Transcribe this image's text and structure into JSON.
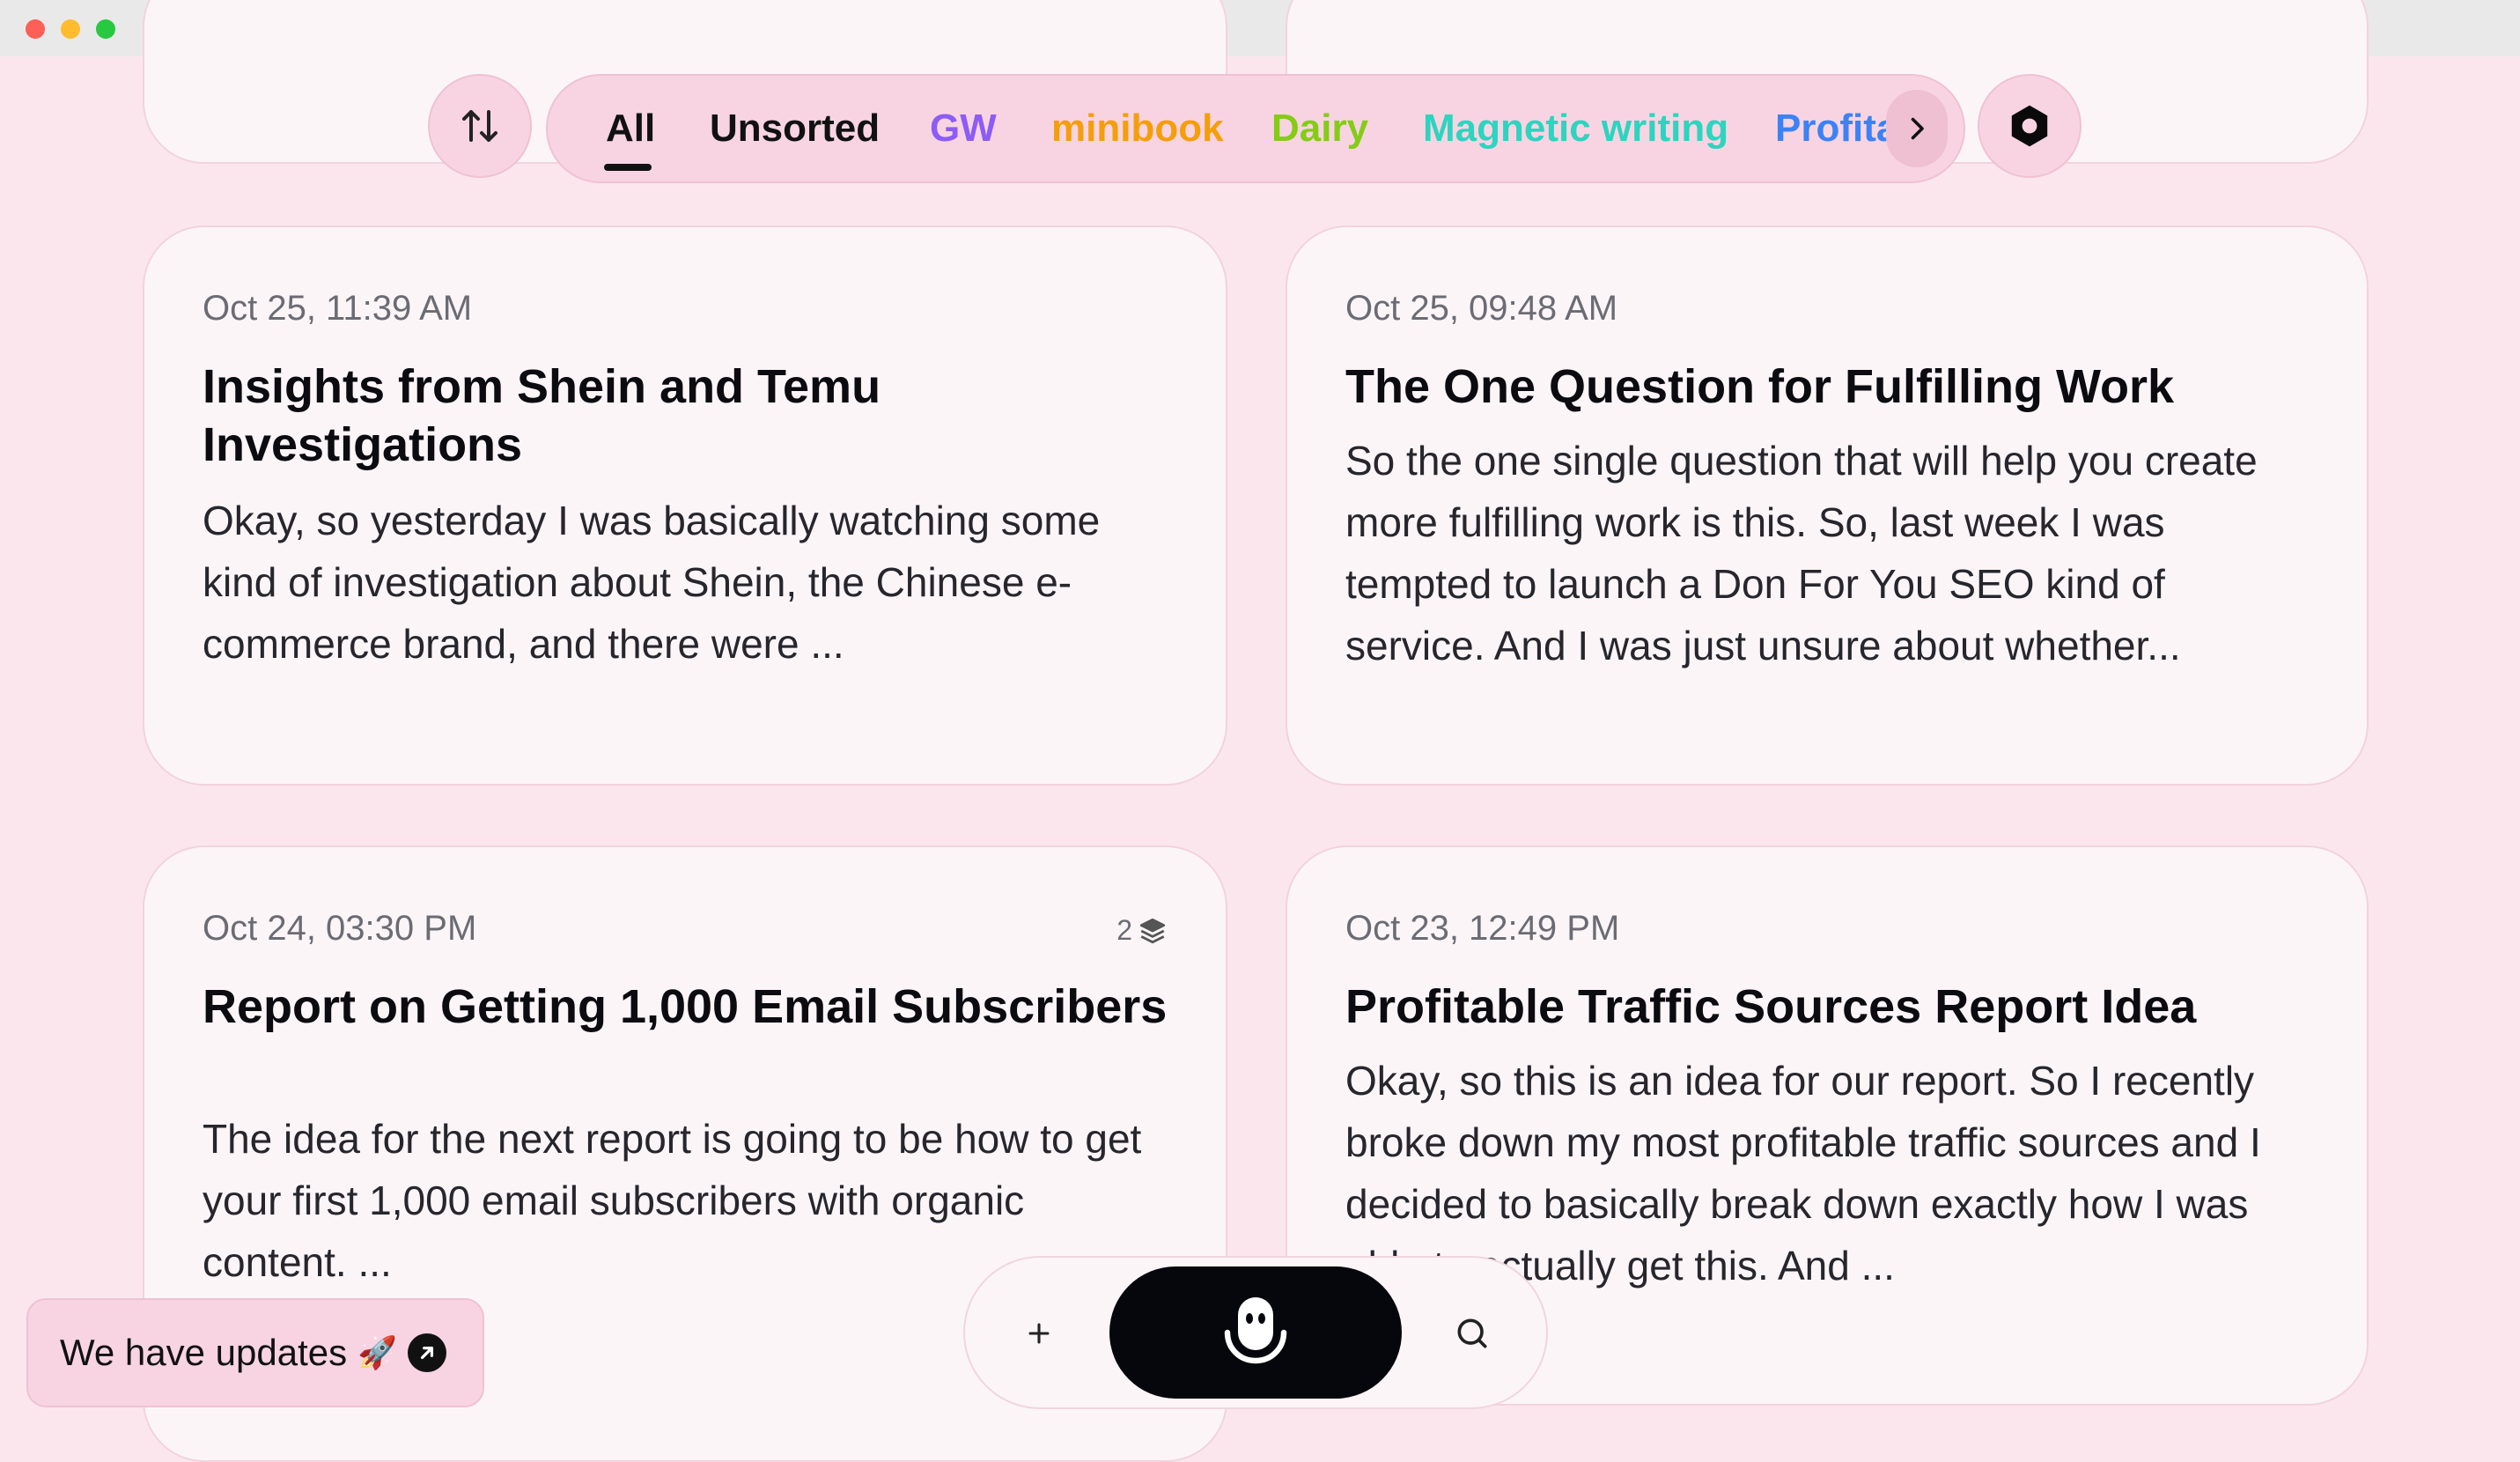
{
  "window": {
    "controls": [
      "close",
      "minimize",
      "zoom"
    ]
  },
  "toolbar": {
    "sort_icon": "sort-arrows-icon",
    "settings_icon": "hexagon-gear-icon",
    "more_tabs_icon": "chevron-right-icon",
    "active_tab": "All",
    "tabs": [
      {
        "label": "All",
        "color": "#111111"
      },
      {
        "label": "Unsorted",
        "color": "#111111"
      },
      {
        "label": "GW",
        "color": "#8b5cf6"
      },
      {
        "label": "minibook",
        "color": "#f59e0b"
      },
      {
        "label": "Dairy",
        "color": "#84cc16"
      },
      {
        "label": "Magnetic writing",
        "color": "#2dd4bf"
      },
      {
        "label": "Profita",
        "color": "#3b82f6"
      }
    ]
  },
  "notes": [
    {
      "date": "Oct 25, 11:39 AM",
      "title": "Insights from Shein and Temu Investigations",
      "excerpt": "Okay, so yesterday I was basically watching some kind of investigation about Shein, the Chinese e-commerce brand, and there were ..."
    },
    {
      "date": "Oct 25, 09:48 AM",
      "title": "The One Question for Fulfilling Work",
      "excerpt": "So the one single question that will help you create more fulfilling work is this. So, last week I was tempted to launch a Don For You SEO kind of service. And I was just unsure about whether..."
    },
    {
      "date": "Oct 24, 03:30 PM",
      "title": "Report on Getting 1,000 Email Subscribers",
      "excerpt": "The idea for the next report is going to be how to get your first 1,000 email subscribers with organic content. ...",
      "stack_count": "2",
      "stack_icon": "stack-layers-icon"
    },
    {
      "date": "Oct 23, 12:49 PM",
      "title": "Profitable Traffic Sources Report Idea",
      "excerpt": "Okay, so this is an idea for our report. So I recently broke down my most profitable traffic sources and I decided to basically break down exactly how I was able to actually get this. And ..."
    }
  ],
  "updates_banner": {
    "label": "We have updates",
    "emoji": "🚀",
    "icon": "arrow-up-right-icon"
  },
  "bottom_bar": {
    "plus_icon": "plus-icon",
    "mic_icon": "microphone-icon",
    "search_icon": "search-icon"
  },
  "colors": {
    "background": "#fbe6ee",
    "card": "#fcf5f8",
    "pill": "#f8d4e2",
    "mic_button": "#06070c"
  }
}
